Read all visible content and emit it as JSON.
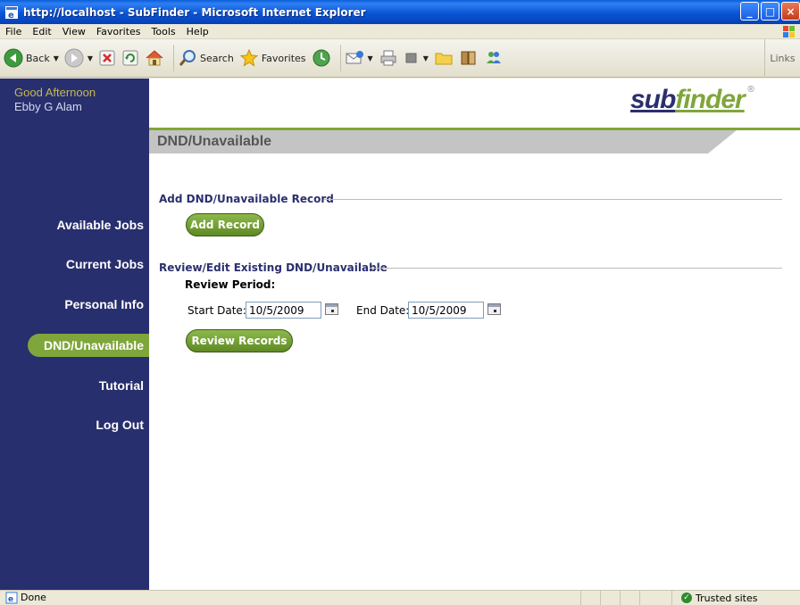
{
  "window": {
    "title": "http://localhost - SubFinder - Microsoft Internet Explorer"
  },
  "menu": [
    "File",
    "Edit",
    "View",
    "Favorites",
    "Tools",
    "Help"
  ],
  "toolbar": {
    "back": "Back",
    "search": "Search",
    "favorites": "Favorites",
    "links": "Links"
  },
  "sidebar": {
    "greeting": "Good Afternoon",
    "user": "Ebby G Alam",
    "nav": [
      "Available Jobs",
      "Current Jobs",
      "Personal Info",
      "DND/Unavailable",
      "Tutorial",
      "Log Out"
    ],
    "active": "DND/Unavailable"
  },
  "logo": {
    "sub": "sub",
    "finder": "finder",
    "mark": "®"
  },
  "page": {
    "heading": "DND/Unavailable",
    "add_section": {
      "title": "Add DND/Unavailable Record",
      "button": "Add Record"
    },
    "review_section": {
      "title": "Review/Edit Existing DND/Unavailable",
      "period_label": "Review Period:",
      "start_label": "Start Date:",
      "start_value": "10/5/2009",
      "end_label": "End Date:",
      "end_value": "10/5/2009",
      "button": "Review Records"
    }
  },
  "status": {
    "text": "Done",
    "zone": "Trusted sites"
  },
  "colors": {
    "sidebar": "#282f6e",
    "accent_green": "#7fa63a",
    "heading_grey": "#c4c4c4",
    "title_blue": "#2b2f6e"
  }
}
